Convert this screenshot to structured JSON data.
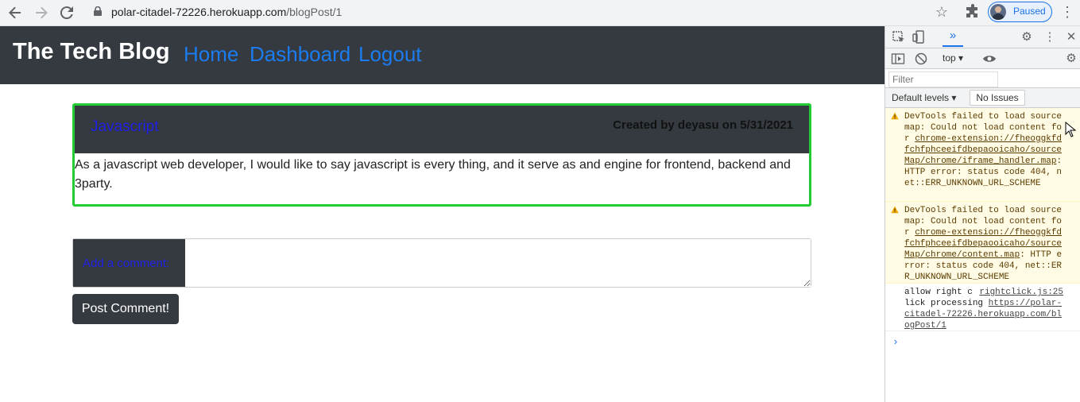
{
  "browser": {
    "url_host": "polar-citadel-72226.herokuapp.com",
    "url_path": "/blogPost/1",
    "profile_status": "Paused",
    "icons": [
      "back-icon",
      "forward-icon",
      "reload-icon",
      "lock-icon",
      "star-icon",
      "extensions-icon",
      "menu-icon"
    ]
  },
  "site": {
    "title": "The Tech Blog",
    "nav": [
      "Home",
      "Dashboard",
      "Logout"
    ]
  },
  "post": {
    "title": "Javascript",
    "meta": "Created by deyasu on 5/31/2021",
    "body": "As a javascript web developer, I would like to say javascript is every thing, and it serve as and engine for frontend, backend and 3party."
  },
  "comment": {
    "label": "Add a comment:",
    "button": "Post Comment!"
  },
  "devtools": {
    "context": "top",
    "filter_placeholder": "Filter",
    "levels": "Default levels",
    "issues": "No Issues",
    "messages": [
      {
        "type": "warning",
        "prefix": "DevTools failed to load source map: Could not load content for ",
        "link": "chrome-extension://fheoggkfdfchfphceeifdbepaooicaho/sourceMap/chrome/iframe_handler.map",
        "suffix": ": HTTP error: status code 404, net::ERR_UNKNOWN_URL_SCHEME"
      },
      {
        "type": "warning",
        "prefix": "DevTools failed to load source map: Could not load content for ",
        "link": "chrome-extension://fheoggkfdfchfphceeifdbepaooicaho/sourceMap/chrome/content.map",
        "suffix": ": HTTP error: status code 404, net::ERR_UNKNOWN_URL_SCHEME"
      },
      {
        "type": "log",
        "prefix": "allow right click processing ",
        "source": "rightclick.js:25",
        "link": "https://polar-citadel-72226.herokuapp.com/blogPost/1"
      }
    ]
  },
  "colors": {
    "header_bg": "#343a40",
    "nav_link": "#1b7cf0",
    "card_border": "#22cc33",
    "post_title": "#1f1fe6"
  }
}
